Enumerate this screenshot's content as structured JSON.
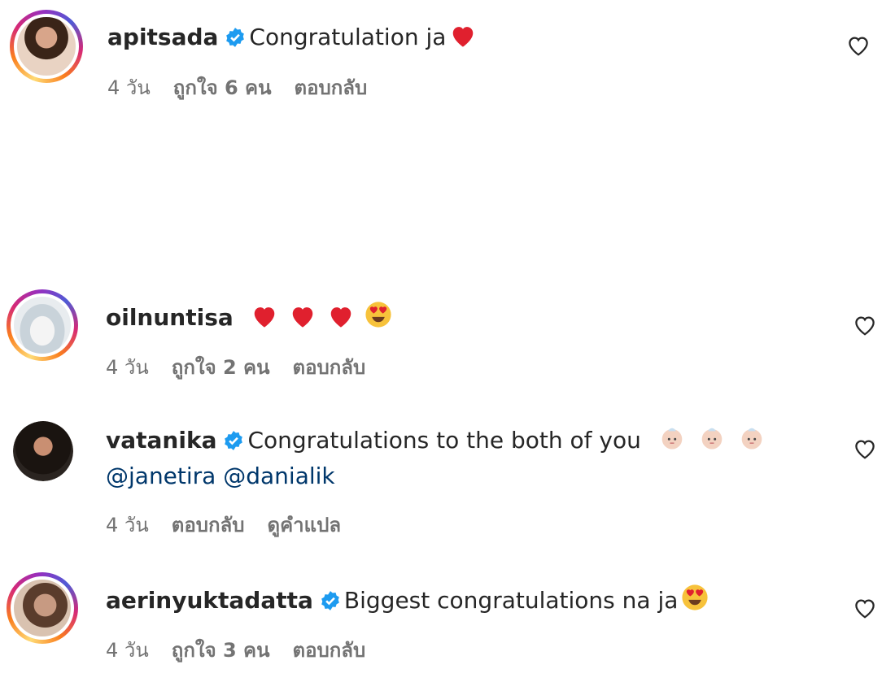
{
  "comments": [
    {
      "username": "apitsada",
      "text": "Congratulation ja",
      "age": "4 วัน",
      "likes": "ถูกใจ 6 คน",
      "reply": "ตอบกลับ"
    },
    {
      "username": "oilnuntisa",
      "age": "4 วัน",
      "likes": "ถูกใจ 2 คน",
      "reply": "ตอบกลับ"
    },
    {
      "username": "vatanika",
      "text": "Congratulations to the both of you",
      "mentions": "@janetira @danialik",
      "age": "4 วัน",
      "reply": "ตอบกลับ",
      "translate": "ดูคำแปล"
    },
    {
      "username": "aerinyuktadatta",
      "text": "Biggest congratulations na ja",
      "age": "4 วัน",
      "likes": "ถูกใจ 3 คน",
      "reply": "ตอบกลับ"
    }
  ],
  "colors": {
    "verified": "#1d9bf0",
    "mention": "#00376b",
    "meta": "#737373",
    "heart_emoji": "#e0202e"
  }
}
